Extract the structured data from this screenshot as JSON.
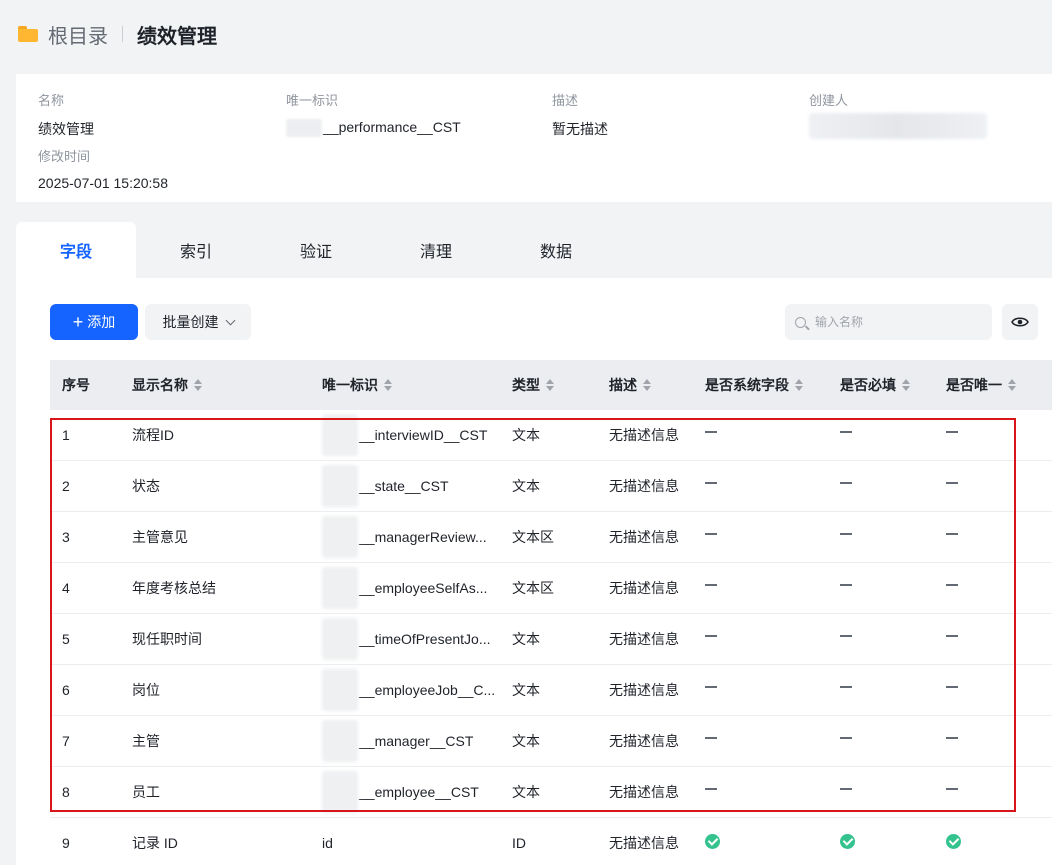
{
  "breadcrumb": {
    "root": "根目录",
    "current": "绩效管理"
  },
  "info": {
    "name_label": "名称",
    "name_value": "绩效管理",
    "key_label": "唯一标识",
    "key_value": "__performance__CST",
    "desc_label": "描述",
    "desc_value": "暂无描述",
    "creator_label": "创建人",
    "modified_label": "修改时间",
    "modified_value": "2025-07-01 15:20:58"
  },
  "tabs": [
    "字段",
    "索引",
    "验证",
    "清理",
    "数据"
  ],
  "active_tab": "字段",
  "toolbar": {
    "add_label": "添加",
    "batch_label": "批量创建",
    "search_placeholder": "输入名称"
  },
  "table": {
    "columns": [
      "序号",
      "显示名称",
      "唯一标识",
      "类型",
      "描述",
      "是否系统字段",
      "是否必填",
      "是否唯一"
    ],
    "rows": [
      {
        "idx": "1",
        "name": "流程ID",
        "key": "__interviewID__CST",
        "type": "文本",
        "desc": "无描述信息",
        "system": false,
        "required": false,
        "unique": false
      },
      {
        "idx": "2",
        "name": "状态",
        "key": "__state__CST",
        "type": "文本",
        "desc": "无描述信息",
        "system": false,
        "required": false,
        "unique": false
      },
      {
        "idx": "3",
        "name": "主管意见",
        "key": "__managerReview...",
        "type": "文本区",
        "desc": "无描述信息",
        "system": false,
        "required": false,
        "unique": false
      },
      {
        "idx": "4",
        "name": "年度考核总结",
        "key": "__employeeSelfAs...",
        "type": "文本区",
        "desc": "无描述信息",
        "system": false,
        "required": false,
        "unique": false
      },
      {
        "idx": "5",
        "name": "现任职时间",
        "key": "__timeOfPresentJo...",
        "type": "文本",
        "desc": "无描述信息",
        "system": false,
        "required": false,
        "unique": false
      },
      {
        "idx": "6",
        "name": "岗位",
        "key": "__employeeJob__C...",
        "type": "文本",
        "desc": "无描述信息",
        "system": false,
        "required": false,
        "unique": false
      },
      {
        "idx": "7",
        "name": "主管",
        "key": "__manager__CST",
        "type": "文本",
        "desc": "无描述信息",
        "system": false,
        "required": false,
        "unique": false
      },
      {
        "idx": "8",
        "name": "员工",
        "key": "__employee__CST",
        "type": "文本",
        "desc": "无描述信息",
        "system": false,
        "required": false,
        "unique": false
      },
      {
        "idx": "9",
        "name": "记录 ID",
        "key": "id",
        "type": "ID",
        "desc": "无描述信息",
        "system": true,
        "required": true,
        "unique": true
      }
    ]
  },
  "colors": {
    "primary": "#1664ff",
    "check": "#34c38f",
    "highlight_border": "#d9151c"
  }
}
